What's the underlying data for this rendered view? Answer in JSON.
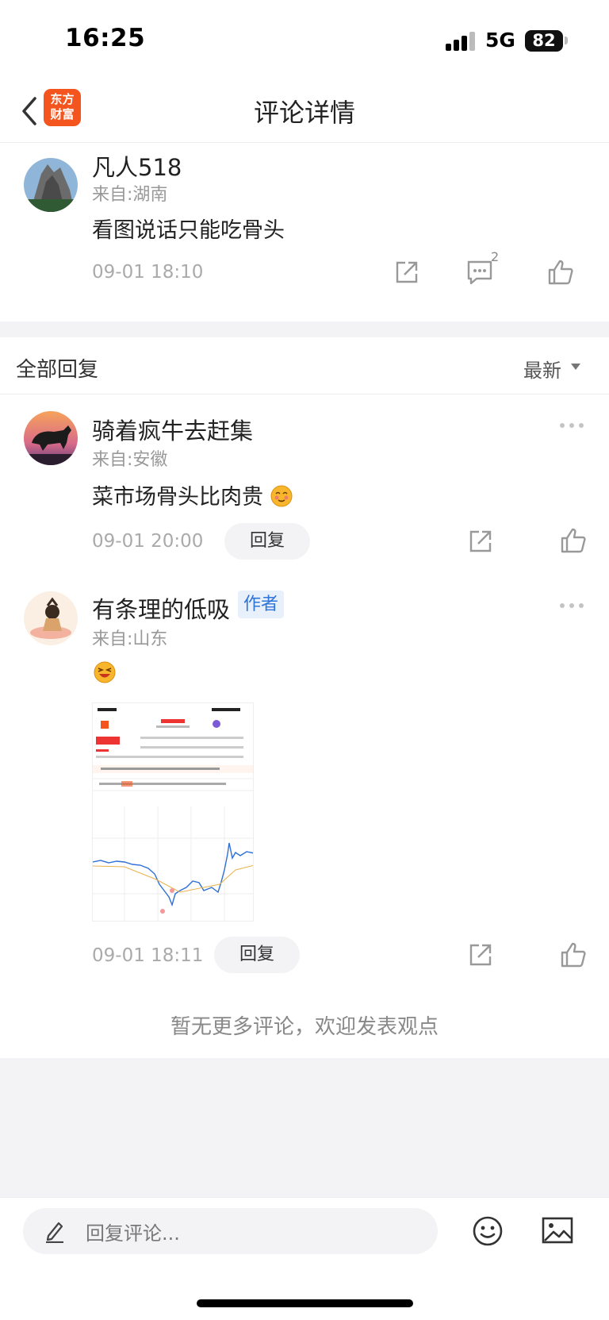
{
  "status": {
    "time": "16:25",
    "network": "5G",
    "battery": "82"
  },
  "nav": {
    "title": "评论详情",
    "logo_line1": "东方",
    "logo_line2": "财富"
  },
  "main_comment": {
    "username": "凡人518",
    "from": "来自:湖南",
    "content": "看图说话只能吃骨头",
    "time": "09-01 18:10",
    "reply_count": "2"
  },
  "replies_header": {
    "title": "全部回复",
    "sort": "最新"
  },
  "replies": [
    {
      "username": "骑着疯牛去赶集",
      "from": "来自:安徽",
      "content": "菜市场骨头比肉贵",
      "time": "09-01 20:00",
      "reply_label": "回复"
    },
    {
      "username": "有条理的低吸",
      "author_badge": "作者",
      "from": "来自:山东",
      "time": "09-01 18:11",
      "reply_label": "回复"
    }
  ],
  "footer": {
    "no_more": "暂无更多评论，欢迎发表观点"
  },
  "input": {
    "placeholder": "回复评论..."
  },
  "colors": {
    "accent": "#f4551e",
    "author_badge": "#2f74d8",
    "background_gray": "#f3f3f5"
  },
  "icons": [
    "back-icon",
    "share-icon",
    "comment-icon",
    "like-icon",
    "more-icon",
    "pen-icon",
    "emoji-icon",
    "image-icon"
  ]
}
